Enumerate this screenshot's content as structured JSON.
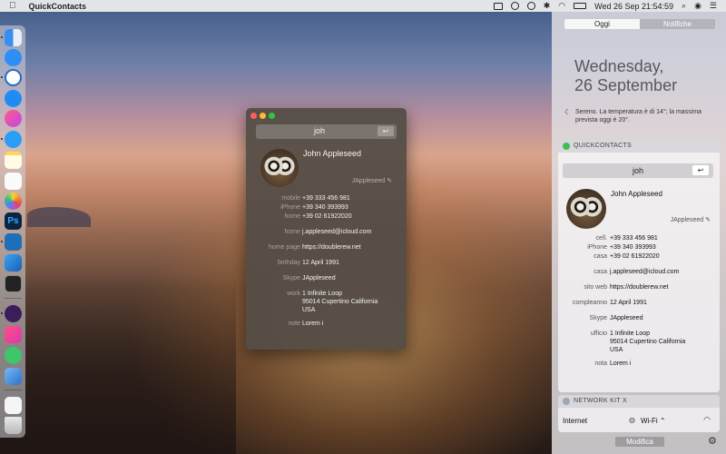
{
  "menubar": {
    "app_name": "QuickContacts",
    "clock": "Wed 26 Sep  21:54:59"
  },
  "popup": {
    "search_value": "joh",
    "contact": {
      "name": "John Appleseed",
      "nickname": "JAppleseed",
      "fields": [
        {
          "label": "mobile",
          "value": "+39 333 456 981"
        },
        {
          "label": "iPhone",
          "value": "+39 340 393993"
        },
        {
          "label": "home",
          "value": "+39 02 61922020"
        },
        {
          "label": "home",
          "value": "j.appleseed@icloud.com"
        },
        {
          "label": "home page",
          "value": "https://doublerew.net"
        },
        {
          "label": "birthday",
          "value": "12 April 1991"
        },
        {
          "label": "Skype",
          "value": "JAppleseed"
        },
        {
          "label": "work",
          "value": "1 Infinite Loop\n95014 Cupertino California\nUSA"
        },
        {
          "label": "note",
          "value": "Lorem i"
        }
      ]
    }
  },
  "notification_center": {
    "tabs": [
      "Oggi",
      "Notifiche"
    ],
    "date_line1": "Wednesday,",
    "date_line2": "26 September",
    "weather": "Sereno. La temperatura è di 14°; la massima prevista oggi è 20°.",
    "quickcontacts": {
      "title": "QUICKCONTACTS",
      "search_value": "joh",
      "contact": {
        "name": "John Appleseed",
        "nickname": "JAppleseed",
        "fields": [
          {
            "label": "cell.",
            "value": "+39 333 456 981"
          },
          {
            "label": "iPhone",
            "value": "+39 340 393993"
          },
          {
            "label": "casa",
            "value": "+39 02 61922020"
          },
          {
            "label": "casa",
            "value": "j.appleseed@icloud.com"
          },
          {
            "label": "sito web",
            "value": "https://doublerew.net"
          },
          {
            "label": "compleanno",
            "value": "12 April 1991"
          },
          {
            "label": "Skype",
            "value": "JAppleseed"
          },
          {
            "label": "ufficio",
            "value": "1 Infinite Loop\n95014 Cupertino California\nUSA"
          },
          {
            "label": "nota",
            "value": "Lorem i"
          }
        ]
      }
    },
    "networkkit": {
      "title": "NETWORK KIT X",
      "label": "Internet",
      "wifi": "Wi-Fi ⌃"
    },
    "edit_button": "Modifica"
  },
  "colors": {
    "close": "#fc5f57",
    "minimize": "#fdbc2e",
    "zoom": "#29c840",
    "qc_icon": "#3fbf4f"
  },
  "dock_icons": [
    "finder-icon",
    "app-store-icon",
    "clock-icon",
    "safari-icon",
    "itunes-icon",
    "messages-icon",
    "notes-icon",
    "reminders-icon",
    "photos-icon",
    "photoshop-icon",
    "vscode-icon",
    "xcode-icon",
    "terminal-icon",
    "quickcontacts-icon",
    "calendar-icon",
    "contacts-icon",
    "mail-icon",
    "document-icon",
    "trash-icon"
  ]
}
